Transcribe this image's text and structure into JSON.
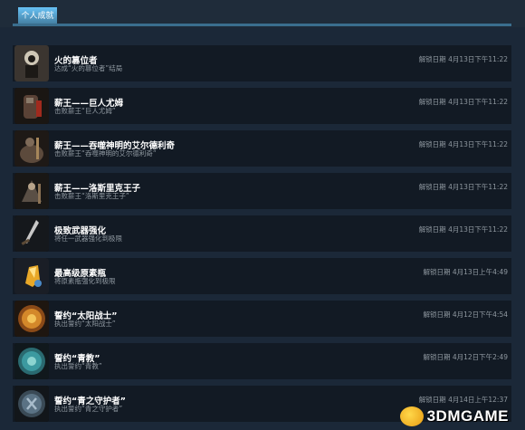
{
  "tabs": [
    {
      "label": "个人成就",
      "active": true
    }
  ],
  "accent": "#67c1f5",
  "achievements": [
    {
      "title": "火的篡位者",
      "description": "达成“火的篡位者”结局",
      "unlocked": "解锁日期 4月13日下午11:22",
      "icon": "usurper-crown-icon"
    },
    {
      "title": "薪王——巨人尤姆",
      "description": "击败薪王“巨人尤姆”",
      "unlocked": "解锁日期 4月13日下午11:22",
      "icon": "yhorm-giant-icon"
    },
    {
      "title": "薪王——吞噬神明的艾尔德利奇",
      "description": "击败薪王“吞噬神明的艾尔德利奇”",
      "unlocked": "解锁日期 4月13日下午11:22",
      "icon": "aldrich-icon"
    },
    {
      "title": "薪王——洛斯里克王子",
      "description": "击败薪王“洛斯里克王子”",
      "unlocked": "解锁日期 4月13日下午11:22",
      "icon": "prince-lothric-icon"
    },
    {
      "title": "极致武器强化",
      "description": "将任一武器强化到极限",
      "unlocked": "解锁日期 4月13日下午11:22",
      "icon": "sword-icon"
    },
    {
      "title": "最高级原素瓶",
      "description": "将原素瓶强化到极限",
      "unlocked": "解锁日期 4月13日上午4:49",
      "icon": "estus-shard-icon"
    },
    {
      "title": "誓约“太阳战士”",
      "description": "执出誓约“太阳战士”",
      "unlocked": "解锁日期 4月12日下午4:54",
      "icon": "sun-medal-icon"
    },
    {
      "title": "誓约“青教”",
      "description": "执出誓约“青教”",
      "unlocked": "解锁日期 4月12日下午2:49",
      "icon": "blue-medal-icon"
    },
    {
      "title": "誓约“青之守护者”",
      "description": "执出誓约“青之守护者”",
      "unlocked": "解锁日期 4月14日上午12:37",
      "icon": "shield-medal-icon"
    }
  ],
  "watermark": {
    "text": "3DMGAME"
  }
}
